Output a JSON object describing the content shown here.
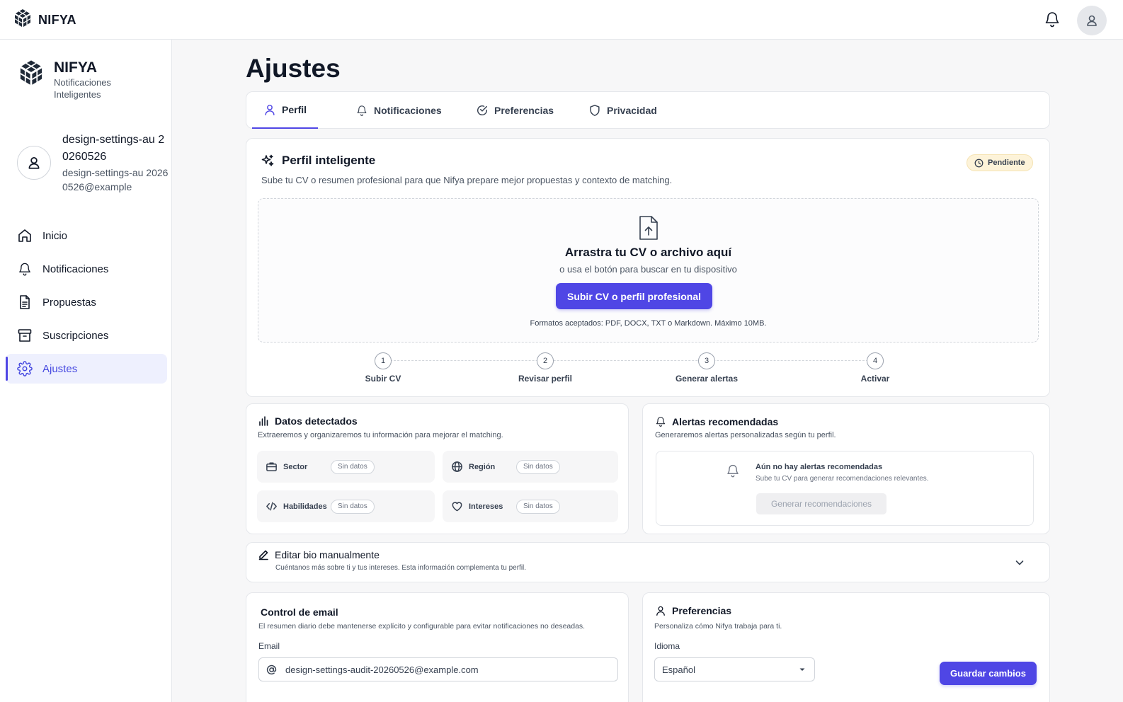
{
  "topbar": {
    "brand": "NIFYA"
  },
  "sidebar": {
    "brand_name": "NIFYA",
    "brand_tagline": "Notificaciones Inteligentes",
    "user_name": "design-settings-au 20260526",
    "user_email": "design-settings-au 20260526@example",
    "nav": [
      {
        "label": "Inicio",
        "icon": "home-icon"
      },
      {
        "label": "Notificaciones",
        "icon": "bell-icon"
      },
      {
        "label": "Propuestas",
        "icon": "document-icon"
      },
      {
        "label": "Suscripciones",
        "icon": "archive-icon"
      },
      {
        "label": "Ajustes",
        "icon": "gear-icon",
        "active": true
      }
    ]
  },
  "page_title": "Ajustes",
  "tabs": [
    {
      "label": "Perfil",
      "icon": "user-icon",
      "active": true
    },
    {
      "label": "Notificaciones",
      "icon": "bell-icon"
    },
    {
      "label": "Preferencias",
      "icon": "check-circle-icon"
    },
    {
      "label": "Privacidad",
      "icon": "shield-icon"
    }
  ],
  "smart_profile": {
    "title": "Perfil inteligente",
    "subtitle": "Sube tu CV o resumen profesional para que Nifya prepare mejor propuestas y contexto de matching.",
    "status_badge": "Pendiente",
    "drop_title": "Arrastra tu CV o archivo aquí",
    "drop_subtitle": "o usa el botón para buscar en tu dispositivo",
    "upload_button": "Subir CV o perfil profesional",
    "formats": "Formatos aceptados: PDF, DOCX, TXT o Markdown. Máximo 10MB.",
    "steps": [
      {
        "num": "1",
        "label": "Subir CV"
      },
      {
        "num": "2",
        "label": "Revisar perfil"
      },
      {
        "num": "3",
        "label": "Generar alertas"
      },
      {
        "num": "4",
        "label": "Activar"
      }
    ]
  },
  "detected": {
    "title": "Datos detectados",
    "subtitle": "Extraeremos y organizaremos tu información para mejorar el matching.",
    "fields": [
      {
        "label": "Sector",
        "value": "Sin datos",
        "icon": "briefcase-icon"
      },
      {
        "label": "Región",
        "value": "Sin datos",
        "icon": "globe-icon"
      },
      {
        "label": "Habilidades",
        "value": "Sin datos",
        "icon": "code-icon"
      },
      {
        "label": "Intereses",
        "value": "Sin datos",
        "icon": "heart-icon"
      }
    ]
  },
  "alerts": {
    "title": "Alertas recomendadas",
    "subtitle": "Generaremos alertas personalizadas según tu perfil.",
    "empty_title": "Aún no hay alertas recomendadas",
    "empty_subtitle": "Sube tu CV para generar recomendaciones relevantes.",
    "generate_button": "Generar recomendaciones"
  },
  "bio": {
    "title": "Editar bio manualmente",
    "subtitle": "Cuéntanos más sobre ti y tus intereses. Esta información complementa tu perfil."
  },
  "email_control": {
    "title": "Control de email",
    "subtitle": "El resumen diario debe mantenerse explícito y configurable para evitar notificaciones no deseadas.",
    "email_label": "Email",
    "email_value": "design-settings-audit-20260526@example.com"
  },
  "preferences": {
    "title": "Preferencias",
    "subtitle": "Personaliza cómo Nifya trabaja para ti.",
    "language_label": "Idioma",
    "language_value": "Español",
    "save_button": "Guardar cambios"
  },
  "colors": {
    "accent": "#4f46e5",
    "active_nav_bg": "#eef0fe",
    "badge_bg": "#fdf3d9"
  }
}
